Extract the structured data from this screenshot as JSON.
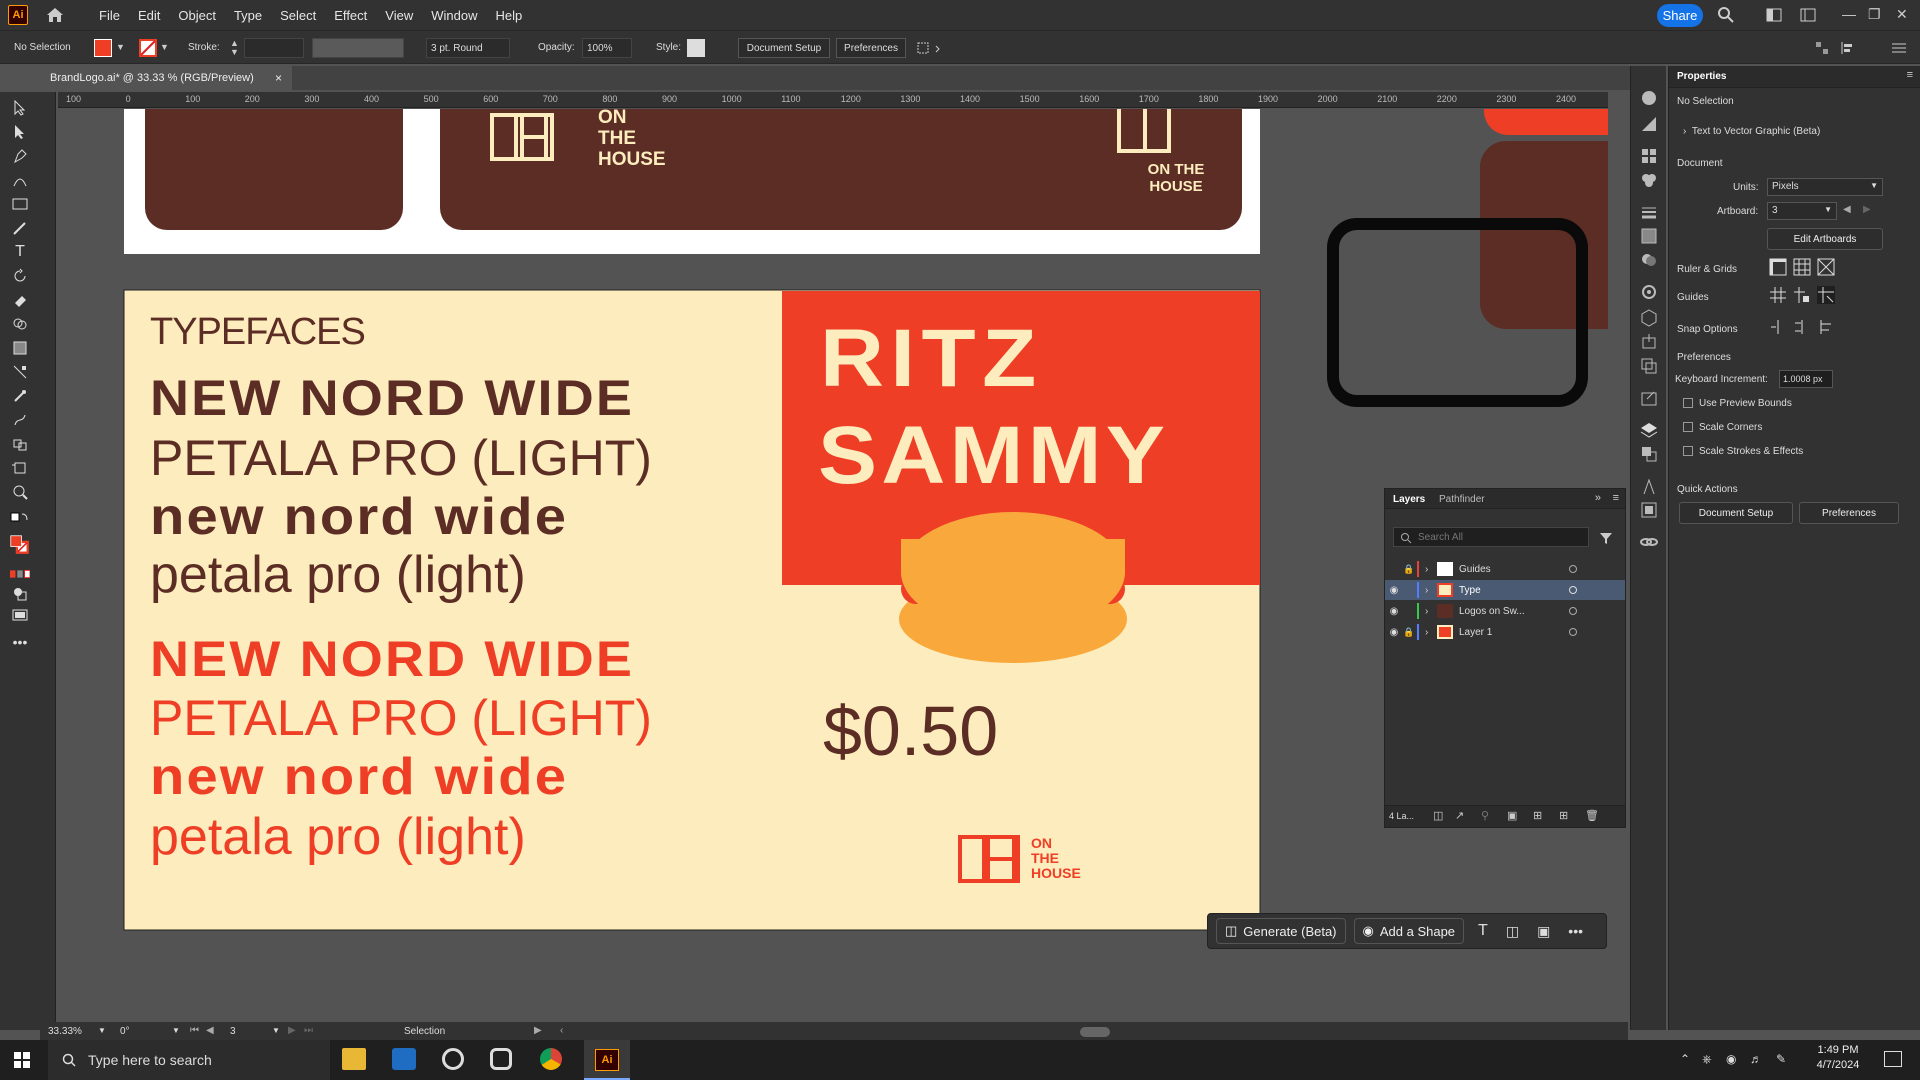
{
  "app": {
    "logo": "Ai",
    "menus": [
      "File",
      "Edit",
      "Object",
      "Type",
      "Select",
      "Effect",
      "View",
      "Window",
      "Help"
    ],
    "share": "Share"
  },
  "control_bar": {
    "selection": "No Selection",
    "stroke_label": "Stroke:",
    "brush": "3 pt. Round",
    "opacity_label": "Opacity:",
    "opacity": "100%",
    "style_label": "Style:",
    "document_setup": "Document Setup",
    "preferences": "Preferences"
  },
  "document": {
    "tab": "BrandLogo.ai* @ 33.33 % (RGB/Preview)",
    "close": "×"
  },
  "ruler": {
    "ticks": [
      "100",
      "0",
      "100",
      "200",
      "300",
      "400",
      "500",
      "600",
      "700",
      "800",
      "900",
      "1000",
      "1100",
      "1200",
      "1300",
      "1400",
      "1500",
      "1600",
      "1700",
      "1800",
      "1900",
      "2000",
      "2100",
      "2200",
      "2300",
      "2400"
    ]
  },
  "artwork": {
    "logo_text": [
      "ON",
      "THE",
      "HOUSE"
    ],
    "logo_text_2": [
      "ON THE",
      "HOUSE"
    ],
    "typefaces_title": "TYPEFACES",
    "lines_dark": [
      "NEW NORD WIDE",
      "PETALA PRO (LIGHT)",
      "new nord wide",
      "petala pro (light)"
    ],
    "lines_red": [
      "NEW NORD WIDE",
      "PETALA PRO (LIGHT)",
      "new nord wide",
      "petala pro (light)"
    ],
    "card_title_1": "RITZ",
    "card_title_2": "SAMMY",
    "price": "$0.50",
    "colors": {
      "brown": "#5b2d24",
      "cream": "#fdecbd",
      "red": "#ef3e26",
      "orange": "#f9a93c"
    }
  },
  "context_bar": {
    "generate": "Generate (Beta)",
    "add_shape": "Add a Shape"
  },
  "layers_panel": {
    "tabs": [
      "Layers",
      "Pathfinder"
    ],
    "search_placeholder": "Search All",
    "layers": [
      {
        "name": "Guides",
        "color": "#e8403a"
      },
      {
        "name": "Type",
        "color": "#4f7fff"
      },
      {
        "name": "Logos on Sw...",
        "color": "#37c94a"
      },
      {
        "name": "Layer 1",
        "color": "#4f7fff"
      }
    ],
    "count": "4 La..."
  },
  "properties": {
    "title": "Properties",
    "selection": "No Selection",
    "text_to_vector": "Text to Vector Graphic (Beta)",
    "document": "Document",
    "units_label": "Units:",
    "units": "Pixels",
    "artboard_label": "Artboard:",
    "artboard": "3",
    "edit_artboards": "Edit Artboards",
    "ruler_grids": "Ruler & Grids",
    "guides": "Guides",
    "snap_options": "Snap Options",
    "preferences": "Preferences",
    "keyboard_increment_label": "Keyboard Increment:",
    "keyboard_increment": "1.0008 px",
    "checkboxes": [
      "Use Preview Bounds",
      "Scale Corners",
      "Scale Strokes & Effects"
    ],
    "quick_actions": "Quick Actions",
    "document_setup": "Document Setup",
    "preferences_btn": "Preferences"
  },
  "status_bar": {
    "zoom": "33.33%",
    "rotation": "0°",
    "artboard": "3",
    "tool": "Selection"
  },
  "taskbar": {
    "search": "Type here to search",
    "time": "1:49 PM",
    "date": "4/7/2024"
  }
}
